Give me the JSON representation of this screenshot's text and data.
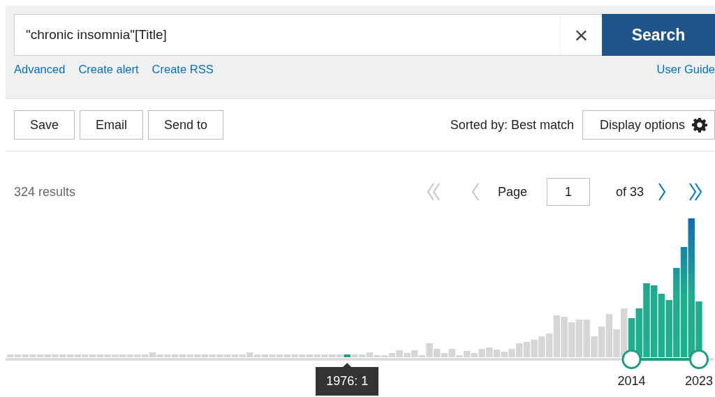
{
  "search": {
    "value": "\"chronic insomnia\"[Title]",
    "clear_icon": "×",
    "button": "Search"
  },
  "links": [
    {
      "label": "Advanced"
    },
    {
      "label": "Create alert"
    },
    {
      "label": "Create RSS"
    }
  ],
  "help_link": "User Guide",
  "actions": [
    "Save",
    "Email",
    "Send to"
  ],
  "sort": "Sorted by: Best match",
  "display_options": "Display options",
  "results": {
    "count": "324 results",
    "page_label": "Page",
    "page": "1",
    "of": "of 33"
  },
  "pager": [
    {
      "kind": "first",
      "disabled": true
    },
    {
      "kind": "prev",
      "disabled": true
    },
    {
      "kind": "next",
      "disabled": false
    },
    {
      "kind": "last",
      "disabled": false
    }
  ],
  "timeline": {
    "tooltip": "1976: 1",
    "range_start": "2014",
    "range_end": "2023"
  }
}
